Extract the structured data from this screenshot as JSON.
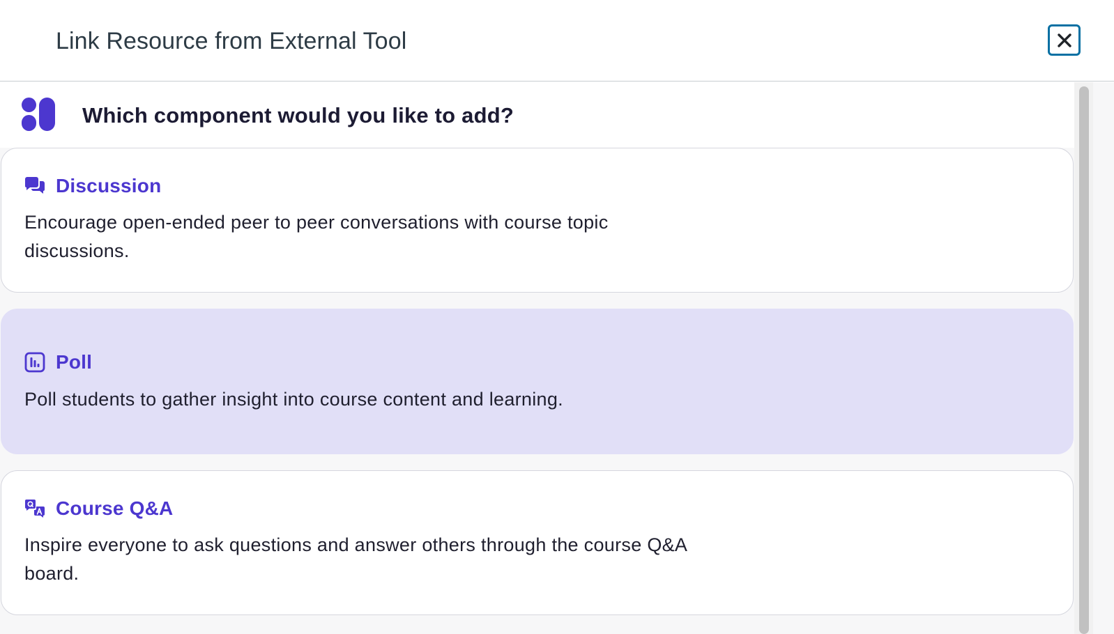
{
  "dialog": {
    "title": "Link Resource from External Tool",
    "close_label": "Close",
    "close_icon": "close-icon"
  },
  "picker": {
    "logo_icon": "app-logo-icon",
    "question": "Which component would you like to add?",
    "options": [
      {
        "icon": "discussion-icon",
        "title": "Discussion",
        "description": "Encourage open-ended peer to peer conversations with course topic discussions.",
        "selected": false
      },
      {
        "icon": "poll-icon",
        "title": "Poll",
        "description": "Poll students to gather insight into course content and learning.",
        "selected": true
      },
      {
        "icon": "qa-icon",
        "title": "Course Q&A",
        "description": "Inspire everyone to ask questions and answer others through the course Q&A board.",
        "selected": false
      }
    ]
  },
  "colors": {
    "accent": "#4c37cf",
    "selected_background": "#e1dff7",
    "focus_ring": "#0770a3",
    "title_text": "#2d3b45"
  }
}
